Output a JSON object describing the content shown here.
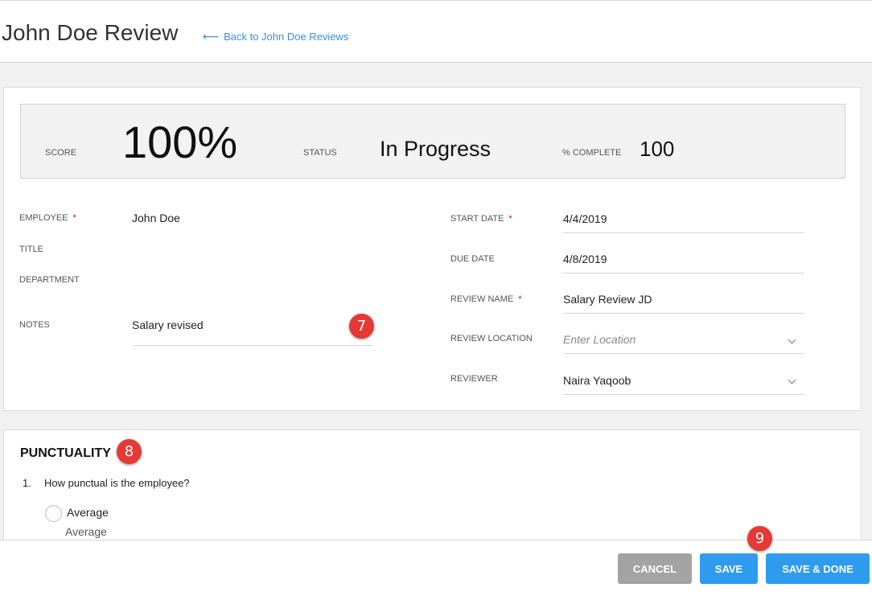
{
  "header": {
    "title": "John Doe Review",
    "back_link": "Back to John Doe Reviews"
  },
  "summary": {
    "score_label": "SCORE",
    "score_value": "100%",
    "status_label": "STATUS",
    "status_value": "In Progress",
    "complete_label": "% COMPLETE",
    "complete_value": "100"
  },
  "left_fields": {
    "employee_label": "EMPLOYEE",
    "employee_value": "John Doe",
    "title_label": "TITLE",
    "department_label": "DEPARTMENT",
    "notes_label": "NOTES",
    "notes_value": "Salary revised"
  },
  "right_fields": {
    "start_date_label": "START DATE",
    "start_date_value": "4/4/2019",
    "due_date_label": "DUE DATE",
    "due_date_value": "4/8/2019",
    "review_name_label": "REVIEW NAME",
    "review_name_value": "Salary Review JD",
    "review_location_label": "REVIEW LOCATION",
    "review_location_placeholder": "Enter Location",
    "reviewer_label": "REVIEWER",
    "reviewer_value": "Naira Yaqoob"
  },
  "required_marker": "*",
  "section": {
    "title": "PUNCTUALITY",
    "question_number": "1.",
    "question_text": "How punctual is the employee?",
    "option_label": "Average",
    "option_description": "Average"
  },
  "footer": {
    "cancel_label": "CANCEL",
    "save_label": "SAVE",
    "save_done_label": "SAVE & DONE"
  },
  "annotations": {
    "badge_7": "7",
    "badge_8": "8",
    "badge_9": "9"
  },
  "colors": {
    "accent": "#2e9bef",
    "link": "#3b8fd9",
    "required": "#d0021b",
    "badge": "#e53935",
    "cancel": "#a3a3a3"
  },
  "icons": {
    "back": "arrow-left-icon",
    "dropdown": "chevron-down-icon",
    "radio": "radio-empty-icon"
  }
}
